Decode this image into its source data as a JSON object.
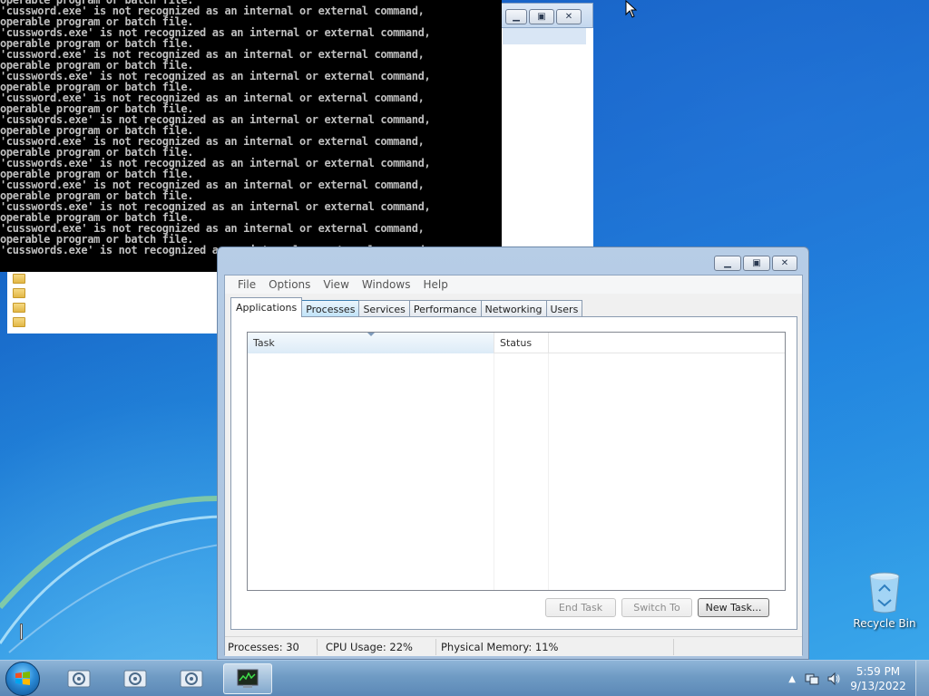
{
  "console": {
    "lines": [
      "operable program or batch file.",
      "'cussword.exe' is not recognized as an internal or external command,",
      "operable program or batch file.",
      "'cusswords.exe' is not recognized as an internal or external command,",
      "operable program or batch file.",
      "'cussword.exe' is not recognized as an internal or external command,",
      "operable program or batch file.",
      "'cusswords.exe' is not recognized as an internal or external command,",
      "operable program or batch file.",
      "'cussword.exe' is not recognized as an internal or external command,",
      "operable program or batch file.",
      "'cusswords.exe' is not recognized as an internal or external command,",
      "operable program or batch file.",
      "'cussword.exe' is not recognized as an internal or external command,",
      "operable program or batch file.",
      "'cusswords.exe' is not recognized as an internal or external command,",
      "operable program or batch file.",
      "'cussword.exe' is not recognized as an internal or external command,",
      "operable program or batch file.",
      "'cusswords.exe' is not recognized as an internal or external command,",
      "operable program or batch file.",
      "'cussword.exe' is not recognized as an internal or external command,",
      "operable program or batch file.",
      "'cusswords.exe' is not recognized as an internal or external command,"
    ]
  },
  "taskmgr": {
    "menu": [
      "File",
      "Options",
      "View",
      "Windows",
      "Help"
    ],
    "tabs": [
      "Applications",
      "Processes",
      "Services",
      "Performance",
      "Networking",
      "Users"
    ],
    "active_tab": "Applications",
    "columns": [
      "Task",
      "Status"
    ],
    "buttons": {
      "end_task": "End Task",
      "switch_to": "Switch To",
      "new_task": "New Task..."
    },
    "status": {
      "processes": "Processes: 30",
      "cpu": "CPU Usage: 22%",
      "memory": "Physical Memory: 11%"
    }
  },
  "desktop": {
    "recycle_bin": "Recycle Bin"
  },
  "taskbar": {
    "time": "5:59 PM",
    "date": "9/13/2022"
  }
}
